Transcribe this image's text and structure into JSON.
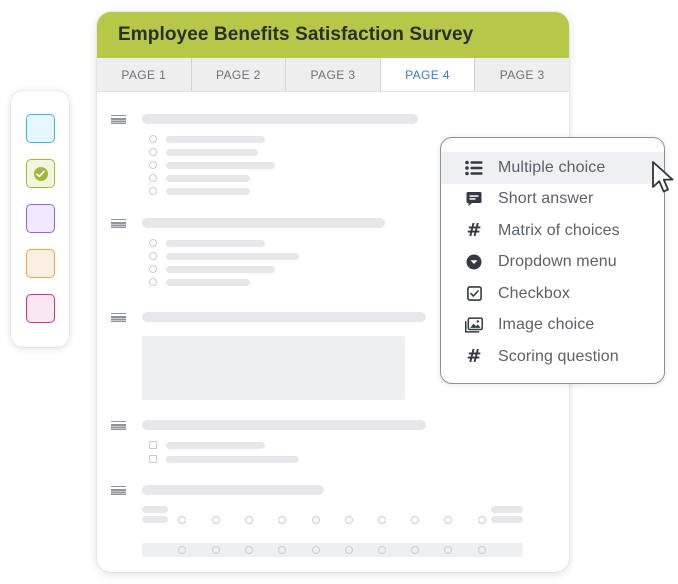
{
  "survey": {
    "title": "Employee Benefits Satisfaction Survey",
    "header_color": "#b7c747",
    "tabs": [
      {
        "label": "PAGE 1",
        "active": false
      },
      {
        "label": "PAGE 2",
        "active": false
      },
      {
        "label": "PAGE 3",
        "active": false
      },
      {
        "label": "PAGE 4",
        "active": true
      },
      {
        "label": "PAGE 3",
        "active": false
      }
    ]
  },
  "palette": {
    "swatches": [
      {
        "name": "cyan",
        "fill": "#e6f7fd",
        "border": "#38b6e0",
        "selected": false
      },
      {
        "name": "green",
        "fill": "#f3f6df",
        "border": "#a5b73a",
        "selected": true
      },
      {
        "name": "purple",
        "fill": "#f1e9fd",
        "border": "#9a5de0",
        "selected": false
      },
      {
        "name": "orange",
        "fill": "#fdf0e2",
        "border": "#f1a241",
        "selected": false
      },
      {
        "name": "pink",
        "fill": "#fbe7f1",
        "border": "#d8307f",
        "selected": false
      }
    ]
  },
  "question_types": {
    "items": [
      {
        "label": "Multiple choice",
        "icon": "list-icon",
        "hovered": true
      },
      {
        "label": "Short answer",
        "icon": "comment-icon",
        "hovered": false
      },
      {
        "label": "Matrix of choices",
        "icon": "hash-icon",
        "hovered": false
      },
      {
        "label": "Dropdown menu",
        "icon": "dropdown-circle-icon",
        "hovered": false
      },
      {
        "label": "Checkbox",
        "icon": "checkbox-icon",
        "hovered": false
      },
      {
        "label": "Image choice",
        "icon": "image-icon",
        "hovered": false
      },
      {
        "label": "Scoring question",
        "icon": "hash-icon",
        "hovered": false
      }
    ]
  }
}
